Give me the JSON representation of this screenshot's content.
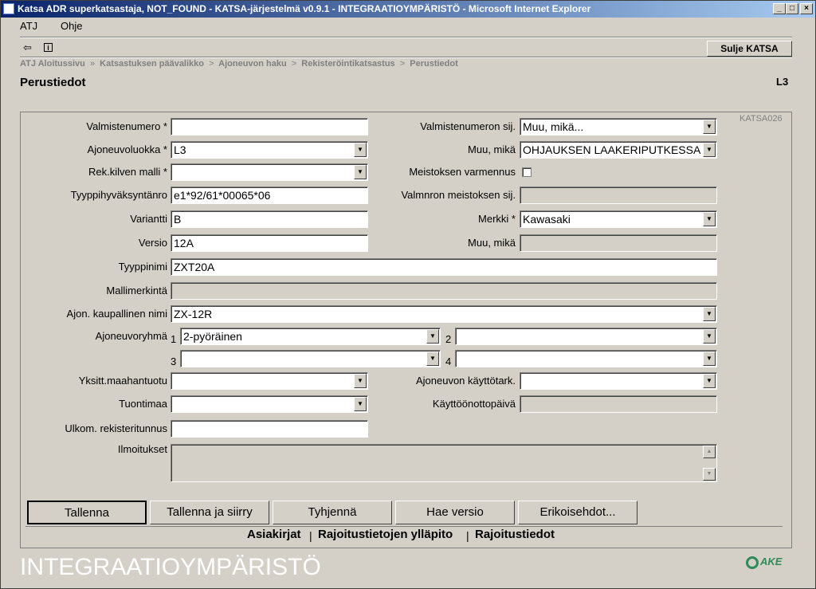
{
  "window": {
    "title": "Katsa ADR superkatsastaja, NOT_FOUND - KATSA-järjestelmä v0.9.1 - INTEGRAATIOYMPÄRISTÖ - Microsoft Internet Explorer",
    "min": "_",
    "max": "□",
    "close": "×"
  },
  "menu": {
    "atj": "ATJ",
    "ohje": "Ohje"
  },
  "toolbar": {
    "back_icon": "⇦",
    "info_icon": "i",
    "close_label": "Sulje KATSA"
  },
  "breadcrumbs": [
    "ATJ Aloitussivu",
    "Katsastuksen päävalikko",
    "Ajoneuvon haku",
    "Rekisteröintikatsastus",
    "Perustiedot"
  ],
  "breadcrumb_sep": "»",
  "breadcrumb_sep2": ">",
  "page": {
    "title": "Perustiedot",
    "code": "L3",
    "form_code": "KATSA026"
  },
  "form": {
    "valmistenumero": {
      "label": "Valmistenumero *",
      "value": ""
    },
    "ajoneuvoluokka": {
      "label": "Ajoneuvoluokka *",
      "value": "L3"
    },
    "rek_kilven_malli": {
      "label": "Rek.kilven malli *",
      "value": ""
    },
    "tyyppihyvaksyntanro": {
      "label": "Tyyppihyväksyntänro",
      "value": "e1*92/61*00065*06"
    },
    "variantti": {
      "label": "Variantti",
      "value": "B"
    },
    "versio": {
      "label": "Versio",
      "value": "12A"
    },
    "tyyppinimi": {
      "label": "Tyyppinimi",
      "value": "ZXT20A"
    },
    "mallimerkinta": {
      "label": "Mallimerkintä",
      "value": ""
    },
    "kaupallinen_nimi": {
      "label": "Ajon. kaupallinen nimi",
      "value": "ZX-12R"
    },
    "ajoneuvoryhma": {
      "label": "Ajoneuvoryhmä",
      "n1": "1",
      "n2": "2",
      "n3": "3",
      "n4": "4",
      "v1": "2-pyöräinen",
      "v2": "",
      "v3": "",
      "v4": ""
    },
    "yksitt_maahantuotu": {
      "label": "Yksitt.maahantuotu",
      "value": ""
    },
    "tuontimaa": {
      "label": "Tuontimaa",
      "value": ""
    },
    "ulkom_rekisteritunnus": {
      "label": "Ulkom. rekisteritunnus",
      "value": ""
    },
    "ilmoitukset": {
      "label": "Ilmoitukset",
      "value": ""
    },
    "valmistenumeron_sij": {
      "label": "Valmistenumeron sij.",
      "value": "Muu, mikä..."
    },
    "muu_mika_1": {
      "label": "Muu, mikä",
      "value": "OHJAUKSEN LAAKERIPUTKESSA"
    },
    "meistoksen_varmennus": {
      "label": "Meistoksen varmennus",
      "checked": false
    },
    "valmnron_meistoksen_sij": {
      "label": "Valmnron meistoksen sij.",
      "value": ""
    },
    "merkki": {
      "label": "Merkki *",
      "value": "Kawasaki"
    },
    "muu_mika_2": {
      "label": "Muu, mikä",
      "value": ""
    },
    "kayttotark": {
      "label": "Ajoneuvon käyttötark.",
      "value": ""
    },
    "kayttoonottopaiva": {
      "label": "Käyttöönottopäivä",
      "value": ""
    }
  },
  "buttons": {
    "tallenna": "Tallenna",
    "tallenna_siirry": "Tallenna ja siirry",
    "tyhjenna": "Tyhjennä",
    "hae_versio": "Hae versio",
    "erikoisehdot": "Erikoisehdot..."
  },
  "footer_links": {
    "asiakirjat": "Asiakirjat",
    "rajoitus_yllapito": "Rajoitustietojen ylläpito",
    "rajoitustiedot": "Rajoitustiedot",
    "sep": "|"
  },
  "environment": "INTEGRAATIOYMPÄRISTÖ",
  "logo_text": "AKE",
  "icons": {
    "dropdown": "▼",
    "scroll_up": "▲",
    "scroll_down": "▼"
  }
}
